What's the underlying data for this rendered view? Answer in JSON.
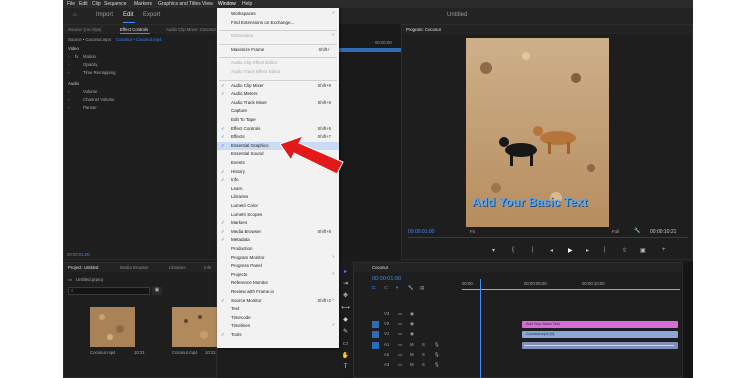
{
  "menubar": {
    "items": [
      "File",
      "Edit",
      "Clip",
      "Sequence",
      "Markers",
      "Graphics and Titles",
      "View",
      "Window",
      "Help"
    ]
  },
  "topbar": {
    "home": "⌂",
    "import": "Import",
    "edit": "Edit",
    "export": "Export",
    "title": "Untitled"
  },
  "source_panel": {
    "tabs": [
      "Source: (no clips)",
      "Effect Controls",
      "Audio Clip Mixer: Coconut"
    ],
    "source_path": "Source • Coconut.mp4",
    "sequence_path": "Coconut • Coconut.mp4",
    "video_header": "Video",
    "video_rows": [
      "Motion",
      "Opacity",
      "Time Remapping"
    ],
    "audio_header": "Audio",
    "audio_rows": [
      "Volume",
      "Channel Volume",
      "Panner"
    ],
    "timecode": "00:00:01:00",
    "time_mark": "00:00:00",
    "fx_mark": "fx"
  },
  "project_panel": {
    "tabs": [
      "Project: Untitled",
      "Media Browser",
      "Libraries",
      "Info"
    ],
    "project_file": "Untitled.prproj",
    "search_placeholder": "",
    "clips": [
      {
        "name": "Coconut.mp4",
        "duration": "10:21"
      },
      {
        "name": "Coconut.mp4",
        "duration": "10:21"
      }
    ]
  },
  "window_menu": {
    "items": [
      {
        "label": "Workspaces",
        "submenu": true,
        "checked": false,
        "disabled": false,
        "shortcut": ""
      },
      {
        "label": "Find Extensions on Exchange...",
        "submenu": false,
        "checked": false,
        "disabled": false,
        "shortcut": ""
      },
      {
        "sep": true
      },
      {
        "label": "Extensions",
        "submenu": true,
        "checked": false,
        "disabled": true,
        "shortcut": ""
      },
      {
        "sep": true
      },
      {
        "label": "Maximize Frame",
        "submenu": false,
        "checked": false,
        "disabled": false,
        "shortcut": "Shift+`"
      },
      {
        "sep": true
      },
      {
        "label": "Audio Clip Effect Editor",
        "submenu": false,
        "checked": false,
        "disabled": true,
        "shortcut": ""
      },
      {
        "label": "Audio Track Effect Editor",
        "submenu": false,
        "checked": false,
        "disabled": true,
        "shortcut": ""
      },
      {
        "sep": true
      },
      {
        "label": "Audio Clip Mixer",
        "submenu": false,
        "checked": true,
        "disabled": false,
        "shortcut": "Shift+9"
      },
      {
        "label": "Audio Meters",
        "submenu": false,
        "checked": true,
        "disabled": false,
        "shortcut": ""
      },
      {
        "label": "Audio Track Mixer",
        "submenu": false,
        "checked": false,
        "disabled": false,
        "shortcut": "Shift+6"
      },
      {
        "label": "Capture",
        "submenu": false,
        "checked": false,
        "disabled": false,
        "shortcut": ""
      },
      {
        "label": "Edit To Tape",
        "submenu": false,
        "checked": false,
        "disabled": false,
        "shortcut": ""
      },
      {
        "label": "Effect Controls",
        "submenu": false,
        "checked": true,
        "disabled": false,
        "shortcut": "Shift+5"
      },
      {
        "label": "Effects",
        "submenu": false,
        "checked": true,
        "disabled": false,
        "shortcut": "Shift+7"
      },
      {
        "label": "Essential Graphics",
        "submenu": false,
        "checked": true,
        "disabled": false,
        "shortcut": "",
        "highlight": true
      },
      {
        "label": "Essential Sound",
        "submenu": false,
        "checked": false,
        "disabled": false,
        "shortcut": ""
      },
      {
        "label": "Events",
        "submenu": false,
        "checked": false,
        "disabled": false,
        "shortcut": ""
      },
      {
        "label": "History",
        "submenu": false,
        "checked": true,
        "disabled": false,
        "shortcut": ""
      },
      {
        "label": "Info",
        "submenu": false,
        "checked": true,
        "disabled": false,
        "shortcut": ""
      },
      {
        "label": "Learn",
        "submenu": false,
        "checked": false,
        "disabled": false,
        "shortcut": ""
      },
      {
        "label": "Libraries",
        "submenu": false,
        "checked": false,
        "disabled": false,
        "shortcut": ""
      },
      {
        "label": "Lumetri Color",
        "submenu": false,
        "checked": false,
        "disabled": false,
        "shortcut": ""
      },
      {
        "label": "Lumetri Scopes",
        "submenu": false,
        "checked": false,
        "disabled": false,
        "shortcut": ""
      },
      {
        "label": "Markers",
        "submenu": false,
        "checked": true,
        "disabled": false,
        "shortcut": ""
      },
      {
        "label": "Media Browser",
        "submenu": false,
        "checked": true,
        "disabled": false,
        "shortcut": "Shift+8"
      },
      {
        "label": "Metadata",
        "submenu": false,
        "checked": true,
        "disabled": false,
        "shortcut": ""
      },
      {
        "label": "Production",
        "submenu": false,
        "checked": false,
        "disabled": false,
        "shortcut": ""
      },
      {
        "label": "Program Monitor",
        "submenu": true,
        "checked": false,
        "disabled": false,
        "shortcut": ""
      },
      {
        "label": "Progress Panel",
        "submenu": false,
        "checked": false,
        "disabled": false,
        "shortcut": ""
      },
      {
        "label": "Projects",
        "submenu": true,
        "checked": false,
        "disabled": false,
        "shortcut": ""
      },
      {
        "label": "Reference Monitor",
        "submenu": false,
        "checked": false,
        "disabled": false,
        "shortcut": ""
      },
      {
        "label": "Review with Frame.io",
        "submenu": false,
        "checked": false,
        "disabled": false,
        "shortcut": ""
      },
      {
        "label": "Source Monitor",
        "submenu": true,
        "checked": true,
        "disabled": false,
        "shortcut": "Shift+2"
      },
      {
        "label": "Text",
        "submenu": false,
        "checked": false,
        "disabled": false,
        "shortcut": ""
      },
      {
        "label": "Timecode",
        "submenu": false,
        "checked": false,
        "disabled": false,
        "shortcut": ""
      },
      {
        "label": "Timelines",
        "submenu": true,
        "checked": false,
        "disabled": false,
        "shortcut": ""
      },
      {
        "label": "Tools",
        "submenu": false,
        "checked": true,
        "disabled": false,
        "shortcut": ""
      }
    ]
  },
  "source_strip": {
    "timecode": "00:00:00"
  },
  "program_monitor": {
    "tab": "Program: Coconut",
    "overlay_text": "Add Your Basic Text",
    "timecode_left": "00:00:01:00",
    "fit": "Fit",
    "quality": "Full",
    "timecode_right": "00:00:10:21"
  },
  "timeline": {
    "tab": "Coconut",
    "timecode": "00:00:01:00",
    "ruler": [
      "00:00",
      "00:00:05:00",
      "00:00:10:00"
    ],
    "tracks": [
      {
        "name": "V3"
      },
      {
        "name": "V2"
      },
      {
        "name": "V1"
      },
      {
        "name": "A1"
      },
      {
        "name": "A2"
      },
      {
        "name": "A3"
      }
    ],
    "clips": [
      {
        "label": "Add Your Basic Text",
        "color": "#d36fd6"
      },
      {
        "label": "Coconut.mp4 [V]",
        "color": "#8aa7d8"
      },
      {
        "label": "",
        "color": "#7f8fb8"
      }
    ]
  },
  "colors": {
    "accent": "#2d8ceb",
    "arrow": "#e01b1b",
    "background": "#1d1d1d"
  },
  "icons": [
    "home-icon",
    "search-icon",
    "play-icon",
    "wrench-icon",
    "selection-tool-icon",
    "razor-tool-icon",
    "pen-tool-icon",
    "hand-tool-icon",
    "text-tool-icon"
  ]
}
